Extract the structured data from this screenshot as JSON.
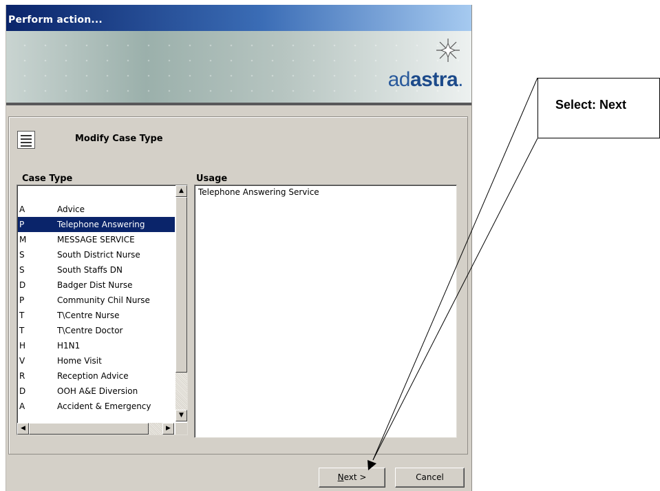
{
  "window": {
    "title": "Perform action..."
  },
  "banner": {
    "logo_part1": "ad",
    "logo_part2": "astra",
    "logo_suffix": "."
  },
  "action": {
    "title": "Modify Case Type",
    "icon": "checklist-icon"
  },
  "case_type": {
    "label": "Case Type",
    "items": [
      {
        "code": "A",
        "name": "Advice",
        "selected": false
      },
      {
        "code": "P",
        "name": "Telephone Answering",
        "selected": true
      },
      {
        "code": "M",
        "name": "MESSAGE SERVICE",
        "selected": false
      },
      {
        "code": "S",
        "name": "South District Nurse",
        "selected": false
      },
      {
        "code": "S",
        "name": "South Staffs DN",
        "selected": false
      },
      {
        "code": "D",
        "name": "Badger Dist Nurse",
        "selected": false
      },
      {
        "code": "P",
        "name": "Community Chil Nurse",
        "selected": false
      },
      {
        "code": "T",
        "name": "T\\Centre Nurse",
        "selected": false
      },
      {
        "code": "T",
        "name": "T\\Centre Doctor",
        "selected": false
      },
      {
        "code": "H",
        "name": "H1N1",
        "selected": false
      },
      {
        "code": "V",
        "name": "Home Visit",
        "selected": false
      },
      {
        "code": "R",
        "name": "Reception Advice",
        "selected": false
      },
      {
        "code": "D",
        "name": "OOH A&E Diversion",
        "selected": false
      },
      {
        "code": "A",
        "name": "Accident & Emergency",
        "selected": false
      }
    ]
  },
  "usage": {
    "label": "Usage",
    "text": "Telephone Answering Service"
  },
  "buttons": {
    "next_prefix": "N",
    "next_rest": "ext >",
    "cancel": "Cancel"
  },
  "callout": {
    "text": "Select: Next"
  },
  "colors": {
    "selection": "#0a246a",
    "title_bar_start": "#0a246a",
    "title_bar_end": "#a6caf0",
    "dialog_face": "#d4d0c8"
  }
}
